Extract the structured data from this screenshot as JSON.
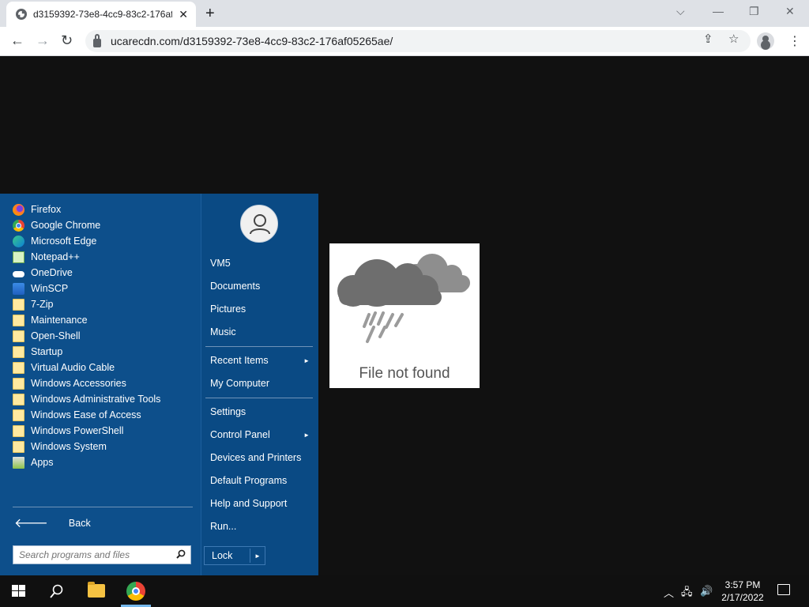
{
  "browser": {
    "tab_title": "d3159392-73e8-4cc9-83c2-176af05265ae/",
    "tab_close": "✕",
    "new_tab": "+",
    "url": "ucarecdn.com/d3159392-73e8-4cc9-83c2-176af05265ae/",
    "window_controls": {
      "dropdown": "⌵",
      "minimize": "—",
      "restore": "❐",
      "close": "✕"
    },
    "nav": {
      "back": "←",
      "forward": "→",
      "reload": "↻"
    },
    "omni": {
      "share": "⇪",
      "bookmark": "☆"
    },
    "menu": "⋮"
  },
  "page": {
    "not_found_text": "File not found"
  },
  "start_menu": {
    "programs": [
      {
        "label": "Firefox",
        "icon": "firefox-icon"
      },
      {
        "label": "Google Chrome",
        "icon": "chrome-icon"
      },
      {
        "label": "Microsoft Edge",
        "icon": "edge-icon"
      },
      {
        "label": "Notepad++",
        "icon": "notepad-icon"
      },
      {
        "label": "OneDrive",
        "icon": "onedrive-icon"
      },
      {
        "label": "WinSCP",
        "icon": "winscp-icon"
      },
      {
        "label": "7-Zip",
        "icon": "folder-icon"
      },
      {
        "label": "Maintenance",
        "icon": "folder-icon"
      },
      {
        "label": "Open-Shell",
        "icon": "folder-icon"
      },
      {
        "label": "Startup",
        "icon": "folder-icon"
      },
      {
        "label": "Virtual Audio Cable",
        "icon": "folder-icon"
      },
      {
        "label": "Windows Accessories",
        "icon": "folder-icon"
      },
      {
        "label": "Windows Administrative Tools",
        "icon": "folder-icon"
      },
      {
        "label": "Windows Ease of Access",
        "icon": "folder-icon"
      },
      {
        "label": "Windows PowerShell",
        "icon": "folder-icon"
      },
      {
        "label": "Windows System",
        "icon": "folder-icon"
      },
      {
        "label": "Apps",
        "icon": "apps-icon"
      }
    ],
    "back_label": "Back",
    "back_arrow": "🡐",
    "search_placeholder": "Search programs and files",
    "right_items": [
      {
        "label": "VM5",
        "submenu": false
      },
      {
        "label": "Documents",
        "submenu": false
      },
      {
        "label": "Pictures",
        "submenu": false
      },
      {
        "label": "Music",
        "submenu": false
      },
      {
        "label": "Recent Items",
        "submenu": true
      },
      {
        "label": "My Computer",
        "submenu": false
      },
      {
        "label": "Settings",
        "submenu": false
      },
      {
        "label": "Control Panel",
        "submenu": true
      },
      {
        "label": "Devices and Printers",
        "submenu": false
      },
      {
        "label": "Default Programs",
        "submenu": false
      },
      {
        "label": "Help and Support",
        "submenu": false
      },
      {
        "label": "Run...",
        "submenu": false
      }
    ],
    "lock_label": "Lock",
    "submenu_caret": "►"
  },
  "taskbar": {
    "time": "3:57 PM",
    "date": "2/17/2022",
    "tray": {
      "chevron": "︿",
      "network": "🖧",
      "volume": "🔊"
    }
  }
}
